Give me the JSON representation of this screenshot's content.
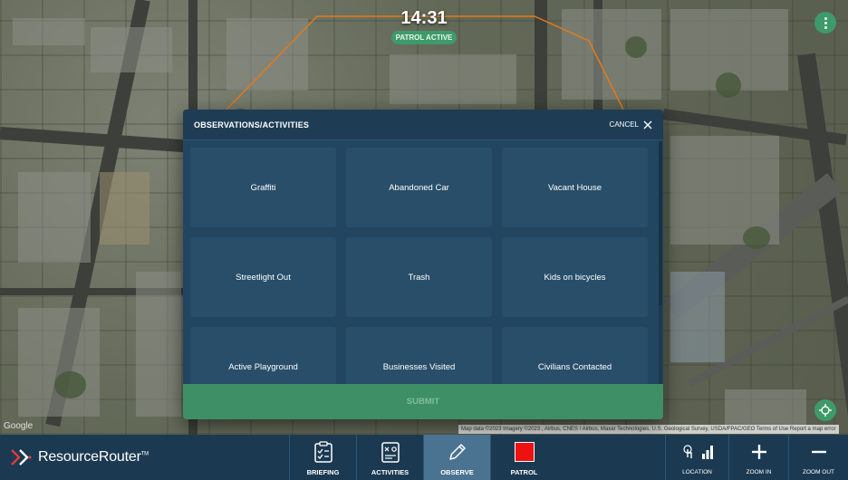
{
  "map": {
    "patrol_timer": "14:31",
    "patrol_status": "PATROL ACTIVE",
    "google_label": "Google",
    "attribution": "Map data ©2023 Imagery ©2023 , Airbus, CNES / Airbus, Maxar Technologies, U.S. Geological Survey, USDA/FPAC/GEO   Terms of Use   Report a map error",
    "patrol_area_color": "#e07a1f"
  },
  "modal": {
    "title": "OBSERVATIONS/ACTIVITIES",
    "cancel_label": "CANCEL",
    "submit_label": "SUBMIT",
    "items": [
      {
        "label": "Graffiti"
      },
      {
        "label": "Abandoned Car"
      },
      {
        "label": "Vacant House"
      },
      {
        "label": "Streetlight Out"
      },
      {
        "label": "Trash"
      },
      {
        "label": "Kids on bicycles"
      },
      {
        "label": "Active Playground"
      },
      {
        "label": "Businesses Visited"
      },
      {
        "label": "Civilians Contacted"
      }
    ]
  },
  "toolbar": {
    "brand": "ResourceRouter",
    "brand_tm": "TM",
    "briefing": "BRIEFING",
    "activities": "ACTIVITIES",
    "observe": "OBSERVE",
    "patrol": "PATROL",
    "location": "LOCATION",
    "zoom_in": "ZOOM IN",
    "zoom_out": "ZOOM OUT",
    "active_tab": "OBSERVE",
    "patrol_color": "#ee1111"
  }
}
